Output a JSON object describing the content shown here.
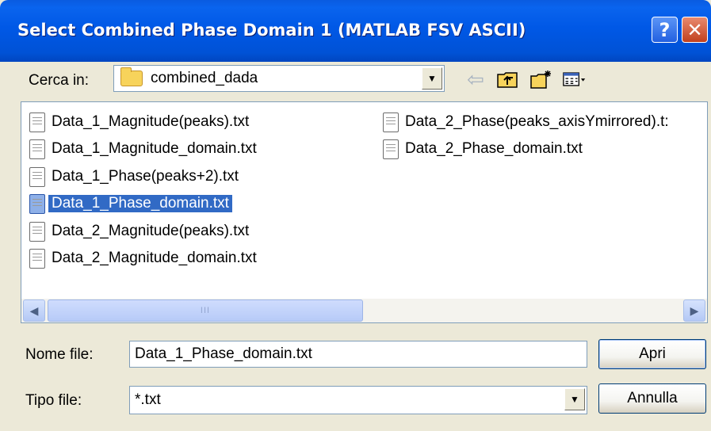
{
  "window": {
    "title": "Select Combined Phase Domain 1 (MATLAB FSV ASCII)",
    "help_label": "?",
    "close_label": "✕"
  },
  "look_in": {
    "label": "Cerca in:",
    "value": "combined_dada",
    "icon": "folder-icon"
  },
  "toolbar": {
    "back_icon": "back-arrow-icon",
    "up_icon": "up-folder-icon",
    "new_folder_icon": "new-folder-icon",
    "views_icon": "views-menu-icon"
  },
  "files": [
    {
      "name": "Data_1_Magnitude(peaks).txt",
      "selected": false
    },
    {
      "name": "Data_1_Magnitude_domain.txt",
      "selected": false
    },
    {
      "name": "Data_1_Phase(peaks+2).txt",
      "selected": false
    },
    {
      "name": "Data_1_Phase_domain.txt",
      "selected": true
    },
    {
      "name": "Data_2_Magnitude(peaks).txt",
      "selected": false
    },
    {
      "name": "Data_2_Magnitude_domain.txt",
      "selected": false
    },
    {
      "name": "Data_2_Phase(peaks_axisYmirrored).t:",
      "selected": false
    },
    {
      "name": "Data_2_Phase_domain.txt",
      "selected": false
    }
  ],
  "file_name": {
    "label": "Nome file:",
    "value": "Data_1_Phase_domain.txt"
  },
  "file_type": {
    "label": "Tipo file:",
    "value": "*.txt"
  },
  "buttons": {
    "open": "Apri",
    "cancel": "Annulla"
  }
}
